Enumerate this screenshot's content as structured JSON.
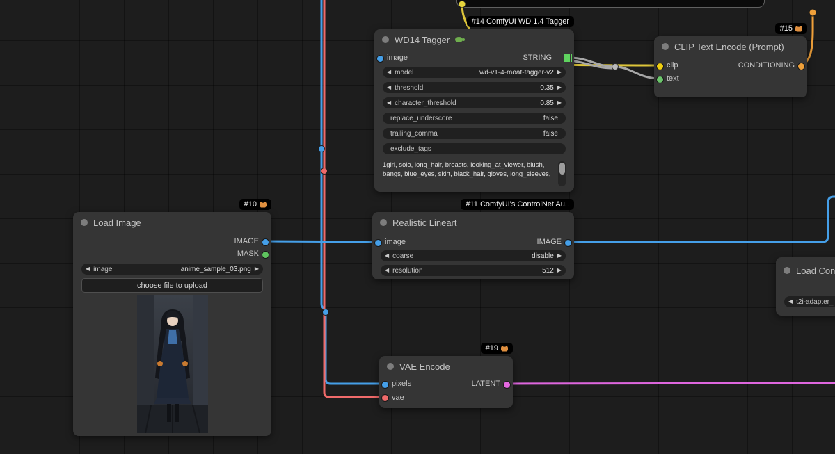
{
  "icons": {
    "arrow_left": "◀",
    "arrow_right": "▶"
  },
  "colors": {
    "wire_image": "#459fe8",
    "wire_vae": "#ef6a6a",
    "wire_clip": "#ddc53a",
    "wire_string": "#a8a8a8",
    "wire_conditioning": "#efa03a",
    "wire_latent": "#de66de",
    "slot_image": "#459fe8",
    "slot_mask": "#5fc45f",
    "slot_clip": "#efce10",
    "slot_text": "#6cc56c",
    "slot_conditioning": "#efa03a",
    "slot_latent": "#e468e0",
    "slot_vae": "#ef6a6a",
    "slot_string_grid": "#5fd35f",
    "node_bg": "#353535",
    "canvas_bg": "#1d1d1d",
    "badge_bg": "#000000"
  },
  "nodes": {
    "wd14_tagger": {
      "badge": "#14 ComfyUI WD 1.4 Tagger",
      "title": "WD14 Tagger",
      "inputs": [
        {
          "label": "image"
        }
      ],
      "outputs": [
        {
          "label": "STRING"
        }
      ],
      "widgets": [
        {
          "label": "model",
          "value": "wd-v1-4-moat-tagger-v2"
        },
        {
          "label": "threshold",
          "value": "0.35"
        },
        {
          "label": "character_threshold",
          "value": "0.85"
        },
        {
          "label": "replace_underscore",
          "value": "false"
        },
        {
          "label": "trailing_comma",
          "value": "false"
        },
        {
          "label": "exclude_tags",
          "value": ""
        }
      ],
      "tags_output": "1girl, solo, long_hair, breasts, looking_at_viewer, blush, bangs, blue_eyes, skirt, black_hair, gloves, long_sleeves,"
    },
    "clip_text_encode": {
      "badge": "#15",
      "title": "CLIP Text Encode (Prompt)",
      "inputs": [
        {
          "label": "clip"
        },
        {
          "label": "text"
        }
      ],
      "outputs": [
        {
          "label": "CONDITIONING"
        }
      ]
    },
    "load_image": {
      "badge": "#10",
      "title": "Load Image",
      "outputs": [
        {
          "label": "IMAGE"
        },
        {
          "label": "MASK"
        }
      ],
      "widgets": [
        {
          "label": "image",
          "value": "anime_sample_03.png"
        }
      ],
      "button": "choose file to upload"
    },
    "realistic_lineart": {
      "badge": "#11 ComfyUI's ControlNet Au..",
      "title": "Realistic Lineart",
      "inputs": [
        {
          "label": "image"
        }
      ],
      "outputs": [
        {
          "label": "IMAGE"
        }
      ],
      "widgets": [
        {
          "label": "coarse",
          "value": "disable"
        },
        {
          "label": "resolution",
          "value": "512"
        }
      ]
    },
    "load_controlnet": {
      "title": "Load Cont",
      "widgets": [
        {
          "value": "t2i-adapter_"
        }
      ]
    },
    "vae_encode": {
      "badge": "#19",
      "title": "VAE Encode",
      "inputs": [
        {
          "label": "pixels"
        },
        {
          "label": "vae"
        }
      ],
      "outputs": [
        {
          "label": "LATENT"
        }
      ]
    }
  }
}
